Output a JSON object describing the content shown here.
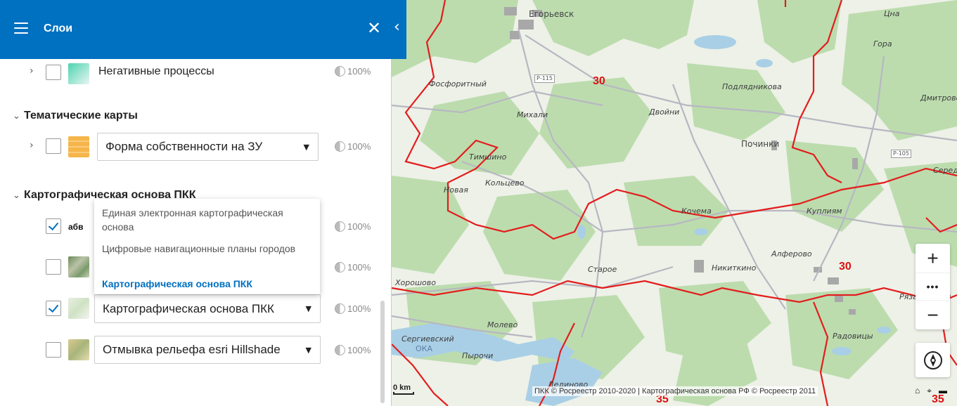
{
  "header": {
    "title": "Слои",
    "close_glyph": "✕",
    "collapse_glyph": "‹"
  },
  "layers": {
    "negative": {
      "label": "Негативные процессы",
      "opacity": "100%"
    },
    "section_thematic": "Тематические карты",
    "ownership": {
      "select_value": "Форма собственности на ЗУ",
      "opacity": "100%"
    },
    "section_base": "Картографическая основа ПКК",
    "text_layer": {
      "thumb_text": "абв",
      "opacity": "100%"
    },
    "satellite": {
      "opacity": "100%"
    },
    "pkk_base": {
      "select_value": "Картографическая основа ПКК",
      "opacity": "100%"
    },
    "hillshade": {
      "select_value": "Отмывка рельефа esri Hillshade",
      "opacity": "100%"
    }
  },
  "dropdown": {
    "options": [
      "Единая электронная картографическая основа",
      "Цифровые навигационные планы городов",
      "Картографическая основа ПКК"
    ],
    "selected_index": 2
  },
  "map": {
    "labels": {
      "egorievsk": "Егорьевск",
      "tsna": "Цна",
      "gora": "Гора",
      "dmitrovsk": "Дмитровск",
      "fosforitny": "Фосфоритный",
      "podlyadnikova": "Подлядникова",
      "mikhali": "Михали",
      "dvoyni": "Двойни",
      "pochinki": "Починки",
      "timshino": "Тимшино",
      "koltsevo": "Кольцево",
      "novaya": "Новая",
      "kochema": "Кочема",
      "kuplium": "Куплиям",
      "sered": "Серед",
      "alferovo": "Алферово",
      "staroe": "Старое",
      "nikitkino": "Никиткино",
      "khoroshovo": "Хорошово",
      "ryazanovsky": "Рязановский",
      "molevo": "Молево",
      "radovitsy": "Радовицы",
      "sergievsky": "Сергиевский",
      "oka": "ОКА",
      "pyrochi": "Пырочи",
      "dedinovo": "Дединово",
      "p115": "Р-115",
      "p105": "Р-105",
      "r30a": "30",
      "r30b": "30",
      "r35a": "35",
      "r35b": "35"
    },
    "scale": "0 km",
    "attribution": "ПКК © Росреестр 2010-2020 | Картографическая основа РФ © Росреестр 2011",
    "zoom_in": "+",
    "zoom_out": "−",
    "more": "•••"
  }
}
